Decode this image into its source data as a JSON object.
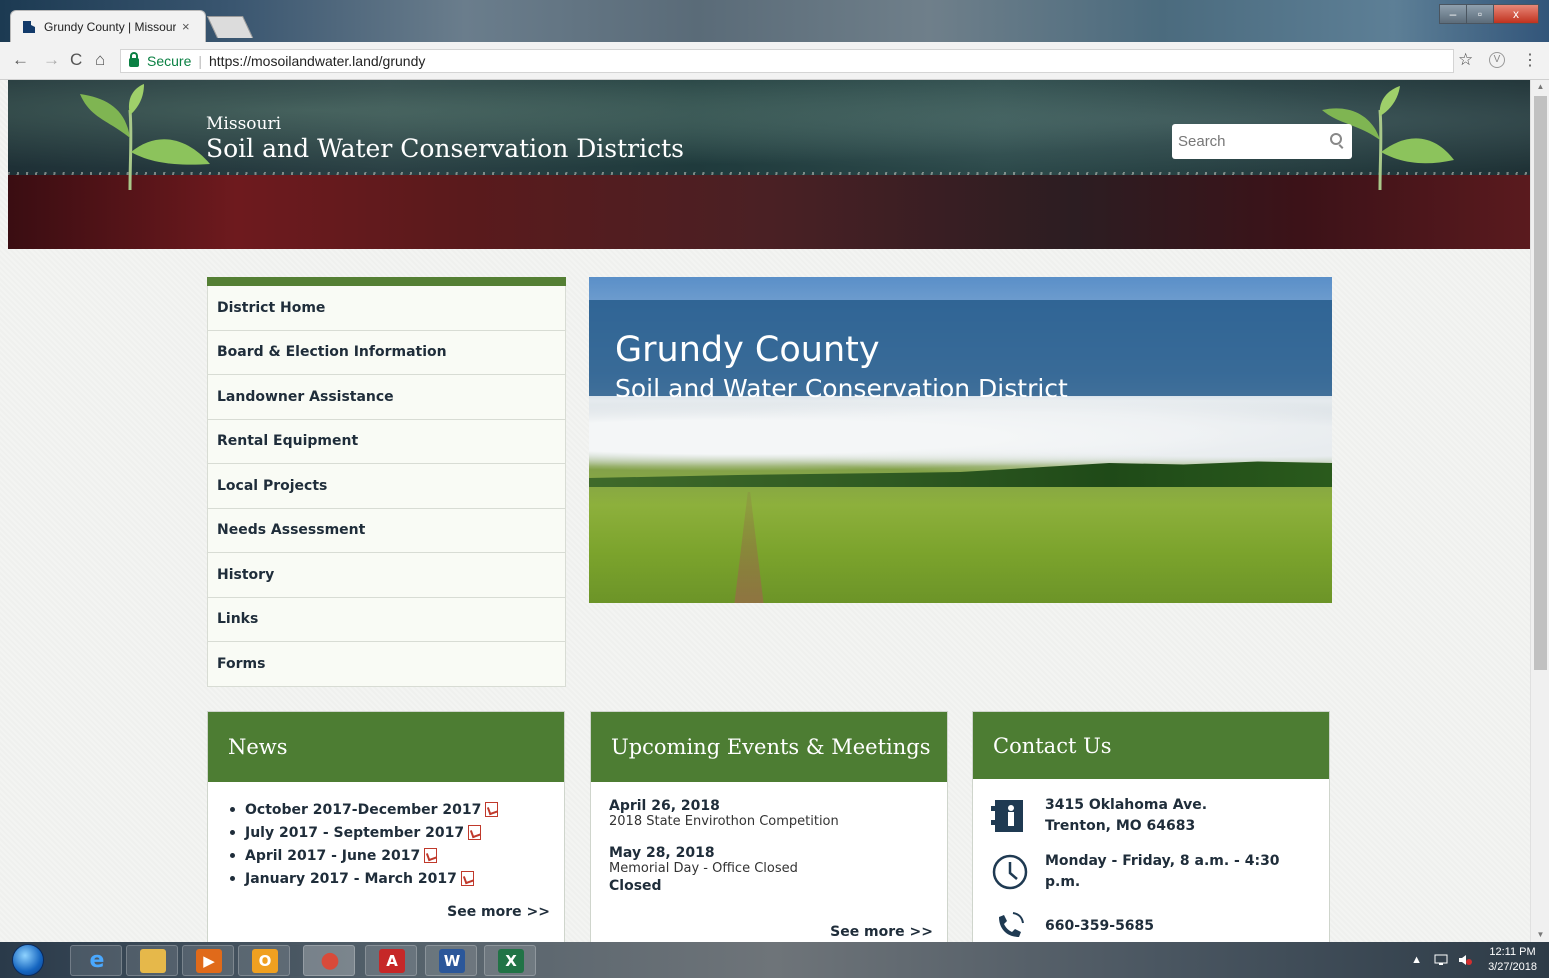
{
  "browser": {
    "tab_title": "Grundy County | Missour",
    "tab_close": "×",
    "secure_label": "Secure",
    "url": "https://mosoilandwater.land/grundy",
    "star_glyph": "☆",
    "menu_glyph": "⋮",
    "extension_glyph": "V",
    "back_glyph": "←",
    "forward_glyph": "→",
    "reload_glyph": "C",
    "home_glyph": "⌂"
  },
  "window_controls": {
    "minimize": "–",
    "maximize": "▫",
    "close": "x"
  },
  "header": {
    "subtitle": "Missouri",
    "title": "Soil and Water Conservation Districts",
    "search_placeholder": "Search"
  },
  "sidebar": {
    "items": [
      {
        "label": "District Home"
      },
      {
        "label": "Board & Election Information"
      },
      {
        "label": "Landowner Assistance"
      },
      {
        "label": "Rental Equipment"
      },
      {
        "label": "Local Projects"
      },
      {
        "label": "Needs Assessment"
      },
      {
        "label": "History"
      },
      {
        "label": "Links"
      },
      {
        "label": "Forms"
      }
    ]
  },
  "hero": {
    "title": "Grundy County",
    "subtitle": "Soil and Water Conservation District"
  },
  "news": {
    "heading": "News",
    "items": [
      {
        "label": "October 2017-December 2017"
      },
      {
        "label": "July 2017 - September 2017"
      },
      {
        "label": "April 2017 - June 2017"
      },
      {
        "label": "January 2017 - March 2017"
      }
    ],
    "see_more": "See more >>"
  },
  "events": {
    "heading": "Upcoming Events & Meetings",
    "items": [
      {
        "date": "April 26, 2018",
        "name": "2018 State Envirothon Competition",
        "extra": ""
      },
      {
        "date": "May 28, 2018",
        "name": "Memorial Day - Office Closed",
        "extra": "Closed"
      }
    ],
    "see_more": "See more >>"
  },
  "contact": {
    "heading": "Contact Us",
    "address_line1": "3415 Oklahoma Ave.",
    "address_line2": "Trenton, MO 64683",
    "hours": "Monday - Friday, 8 a.m. - 4:30 p.m.",
    "phone": "660-359-5685"
  },
  "taskbar": {
    "time": "12:11 PM",
    "date": "3/27/2018",
    "apps": [
      {
        "icon": "internet-explorer-icon",
        "glyph": "e",
        "color": "#1e88e5"
      },
      {
        "icon": "file-explorer-icon",
        "glyph": "",
        "color": "#e6b84a"
      },
      {
        "icon": "media-player-icon",
        "glyph": "▶",
        "color": "#e06a1a"
      },
      {
        "icon": "outlook-icon",
        "glyph": "O",
        "color": "#f0a020"
      },
      {
        "icon": "chrome-icon",
        "glyph": "●",
        "color": "#d84a3a"
      },
      {
        "icon": "acrobat-icon",
        "glyph": "A",
        "color": "#c62828"
      },
      {
        "icon": "word-icon",
        "glyph": "W",
        "color": "#2b579a"
      },
      {
        "icon": "excel-icon",
        "glyph": "X",
        "color": "#217346"
      }
    ]
  },
  "colors": {
    "accent_green": "#4d7d33",
    "hero_band": "#265c8c",
    "text_dark": "#1f2d3a"
  }
}
